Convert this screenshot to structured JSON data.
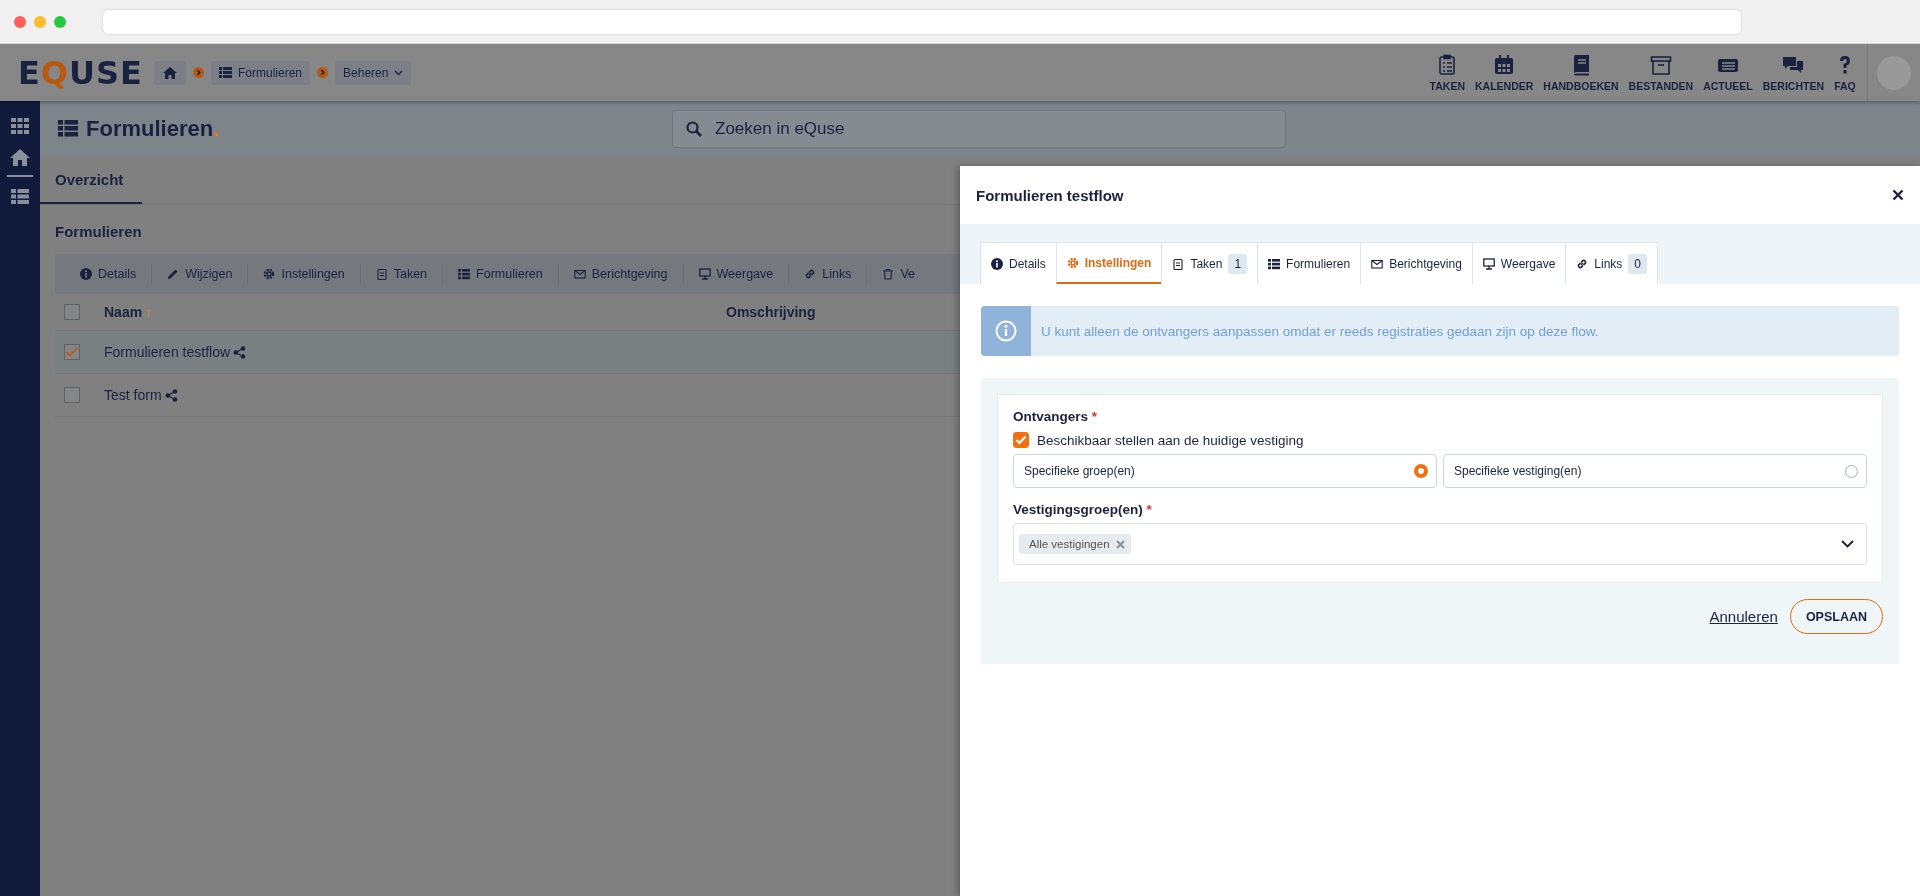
{
  "header": {
    "logo": [
      {
        "text": "E",
        "accent": false
      },
      {
        "text": "Q",
        "accent": true
      },
      {
        "text": "USE",
        "accent": false
      }
    ],
    "breadcrumbs": [
      {
        "label": "Formulieren",
        "kind": "link"
      },
      {
        "label": "Beheren",
        "kind": "menu"
      }
    ],
    "nav": [
      {
        "label": "TAKEN"
      },
      {
        "label": "KALENDER"
      },
      {
        "label": "HANDBOEKEN"
      },
      {
        "label": "BESTANDEN"
      },
      {
        "label": "ACTUEEL"
      },
      {
        "label": "BERICHTEN"
      },
      {
        "label": "FAQ"
      }
    ]
  },
  "page": {
    "title": "Formulieren",
    "title_mark": ".",
    "search": {
      "placeholder": "Zoeken in eQuse"
    },
    "tabs": [
      {
        "label": "Overzicht",
        "selected": true
      }
    ],
    "section_title": "Formulieren",
    "toolbar": [
      "Details",
      "Wijzigen",
      "Instellingen",
      "Taken",
      "Formulieren",
      "Berichtgeving",
      "Weergave",
      "Links",
      "Ve"
    ],
    "table": {
      "all_checked": false,
      "columns": [
        {
          "label": "Naam",
          "sort_mark": "↑"
        },
        {
          "label": "Omschrijving"
        }
      ],
      "rows": [
        {
          "name": "Formulieren testflow",
          "checked": true
        },
        {
          "name": "Test form",
          "checked": false
        }
      ]
    }
  },
  "modal": {
    "title": "Formulieren testflow",
    "tabs": [
      {
        "label": "Details",
        "selected": false
      },
      {
        "label": "Instellingen",
        "selected": true
      },
      {
        "label": "Taken",
        "count": "1",
        "selected": false
      },
      {
        "label": "Formulieren",
        "selected": false
      },
      {
        "label": "Berichtgeving",
        "selected": false
      },
      {
        "label": "Weergave",
        "selected": false
      },
      {
        "label": "Links",
        "count": "0",
        "selected": false
      }
    ],
    "info": "U kunt alleen de ontvangers aanpassen omdat er reeds registraties gedaan zijn op deze flow.",
    "recipients": {
      "label": "Ontvangers",
      "required_mark": "*",
      "checkbox": {
        "label": "Beschikbaar stellen aan de huidige vestiging",
        "checked": true
      },
      "options": [
        {
          "label": "Specifieke groep(en)",
          "selected": true
        },
        {
          "label": "Specifieke vestiging(en)",
          "selected": false
        }
      ]
    },
    "groups": {
      "label": "Vestigingsgroep(en)",
      "required_mark": "*",
      "tags": [
        "Alle vestigingen"
      ]
    },
    "cancel": "Annuleren",
    "save": "OPSLAAN"
  }
}
